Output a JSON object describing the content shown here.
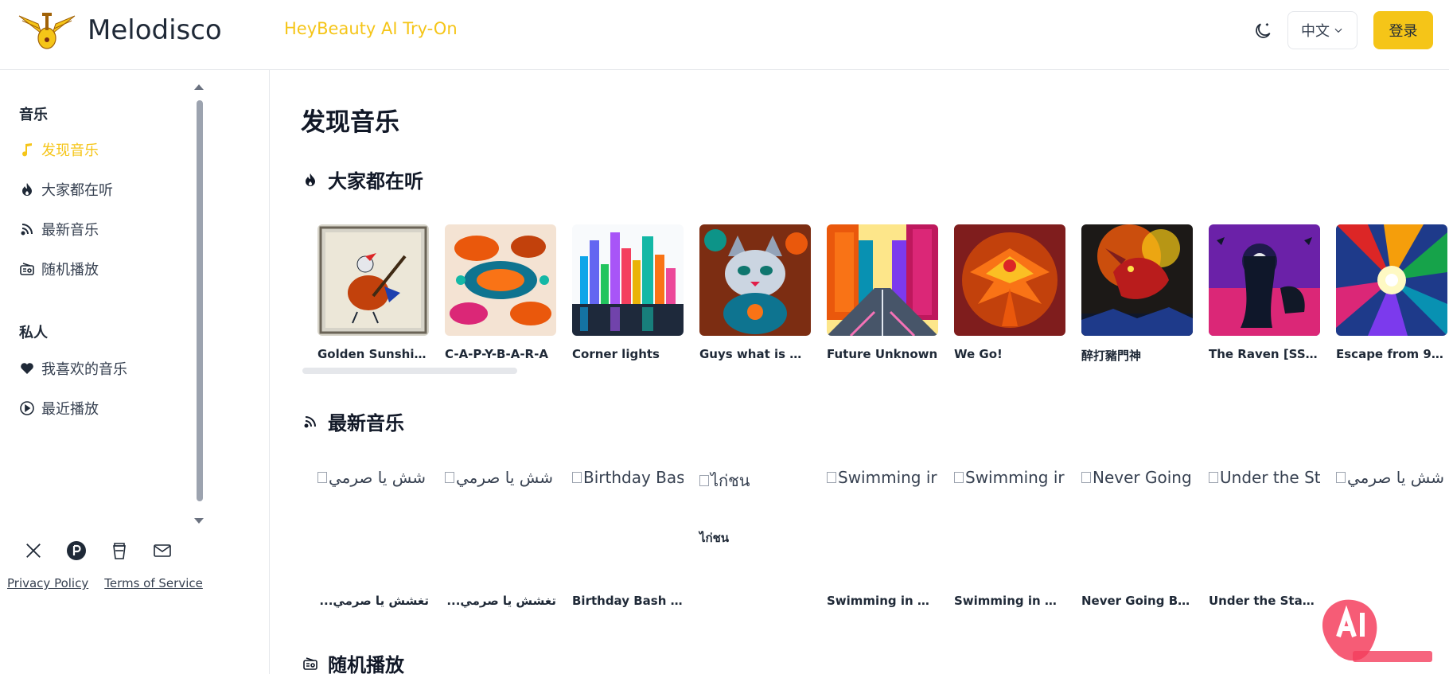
{
  "header": {
    "brand": "Melodisco",
    "promo": "HeyBeauty AI Try-On",
    "lang": "中文",
    "login": "登录"
  },
  "sidebar": {
    "section_music": "音乐",
    "items_music": [
      {
        "label": "发现音乐",
        "icon": "music-note-icon",
        "active": true
      },
      {
        "label": "大家都在听",
        "icon": "flame-icon"
      },
      {
        "label": "最新音乐",
        "icon": "rss-icon"
      },
      {
        "label": "随机播放",
        "icon": "radio-icon"
      }
    ],
    "section_private": "私人",
    "items_private": [
      {
        "label": "我喜欢的音乐",
        "icon": "heart-icon"
      },
      {
        "label": "最近播放",
        "icon": "play-circle-icon"
      }
    ],
    "socials": [
      "x-icon",
      "product-hunt-icon",
      "coffee-icon",
      "mail-icon"
    ],
    "privacy": "Privacy Policy",
    "terms": "Terms of Service"
  },
  "main": {
    "title": "发现音乐",
    "trending": {
      "heading": "大家都在听",
      "cards": [
        {
          "title": "Golden Sunshine..."
        },
        {
          "title": "C-A-P-Y-B-A-R-A"
        },
        {
          "title": "Corner lights"
        },
        {
          "title": "Guys what is wr..."
        },
        {
          "title": "Future Unknown"
        },
        {
          "title": "We Go!"
        },
        {
          "title": "醉打豬門神"
        },
        {
          "title": "The Raven [SSC3..."
        },
        {
          "title": "Escape from 9 to..."
        }
      ]
    },
    "latest": {
      "heading": "最新音乐",
      "cards": [
        {
          "alt": "شش يا صرمي",
          "title": "تغشش يا صرمي..."
        },
        {
          "alt": "شش يا صرمي",
          "title": "تغشش يا صرمي..."
        },
        {
          "alt": "Birthday Bas",
          "title": "Birthday Bash fo..."
        },
        {
          "alt": "ไก่ชน",
          "sub": "ไก่ชน",
          "title": ""
        },
        {
          "alt": "Swimming ir",
          "title": "Swimming in Dr..."
        },
        {
          "alt": "Swimming ir",
          "title": "Swimming in Dr..."
        },
        {
          "alt": "Never Going",
          "title": "Never Going Back"
        },
        {
          "alt": "Under the St",
          "title": "Under the Starlit"
        },
        {
          "alt": "شش يا صرمي",
          "title": ""
        }
      ]
    },
    "random": {
      "heading": "随机播放"
    }
  },
  "colors": {
    "accent": "#f5c518",
    "text": "#1f2937",
    "border": "#e5e7eb"
  }
}
